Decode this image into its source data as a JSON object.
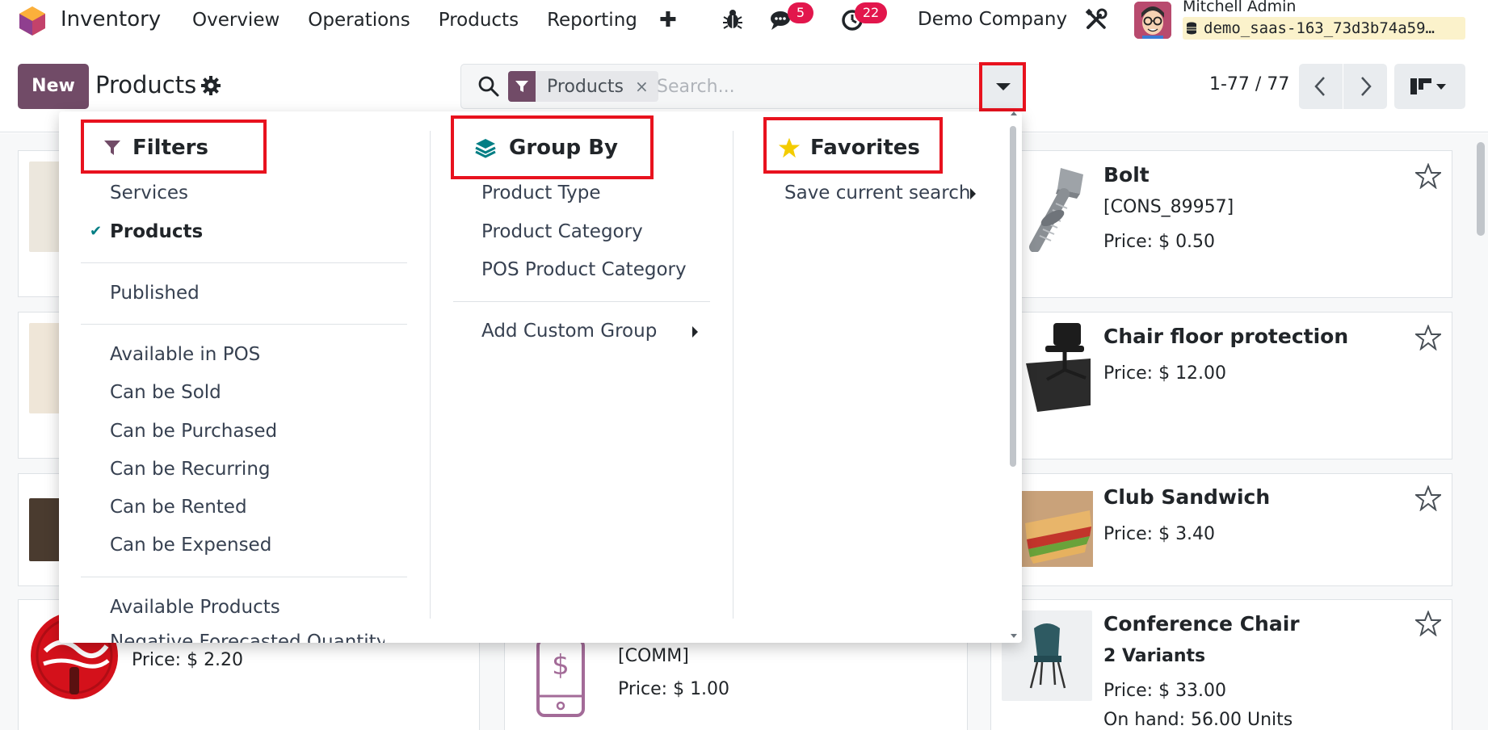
{
  "navbar": {
    "app_name": "Inventory",
    "menu": [
      "Overview",
      "Operations",
      "Products",
      "Reporting"
    ],
    "plus": "✚",
    "messages_count": "5",
    "activities_count": "22",
    "company": "Demo Company",
    "user_name": "Mitchell Admin",
    "db_name": "demo_saas-163_73d3b74a59…"
  },
  "control": {
    "new_label": "New",
    "breadcrumb": "Products",
    "facet_label": "Products",
    "facet_close": "×",
    "search_placeholder": "Search...",
    "pager": "1-77 / 77"
  },
  "dropdown": {
    "filters": {
      "title": "Filters",
      "group1": [
        {
          "label": "Services",
          "checked": false
        },
        {
          "label": "Products",
          "checked": true
        }
      ],
      "group2": [
        "Published"
      ],
      "group3": [
        "Available in POS",
        "Can be Sold",
        "Can be Purchased",
        "Can be Recurring",
        "Can be Rented",
        "Can be Expensed"
      ],
      "group4": [
        "Available Products",
        "Negative Forecasted Quantity"
      ]
    },
    "groupby": {
      "title": "Group By",
      "items": [
        "Product Type",
        "Product Category",
        "POS Product Category"
      ],
      "custom": "Add Custom Group"
    },
    "favorites": {
      "title": "Favorites",
      "save": "Save current search"
    }
  },
  "cards": {
    "bolt": {
      "title": "Bolt",
      "ref": "[CONS_89957]",
      "price": "Price: $ 0.50"
    },
    "chair_floor": {
      "title": "Chair floor protection",
      "price": "Price: $ 12.00"
    },
    "club": {
      "title": "Club Sandwich",
      "price": "Price: $ 3.40"
    },
    "conference": {
      "title": "Conference Chair",
      "variants": "2 Variants",
      "price": "Price: $ 33.00",
      "onhand": "On hand: 56.00 Units"
    },
    "coke": {
      "price": "Price: $ 2.20"
    },
    "comm": {
      "ref": "[COMM]",
      "price": "Price: $ 1.00"
    }
  },
  "colors": {
    "brand": "#714b67",
    "highlight": "#e8121e",
    "badge": "#e2164c",
    "teal": "#017e84",
    "star": "#f3cc00"
  }
}
